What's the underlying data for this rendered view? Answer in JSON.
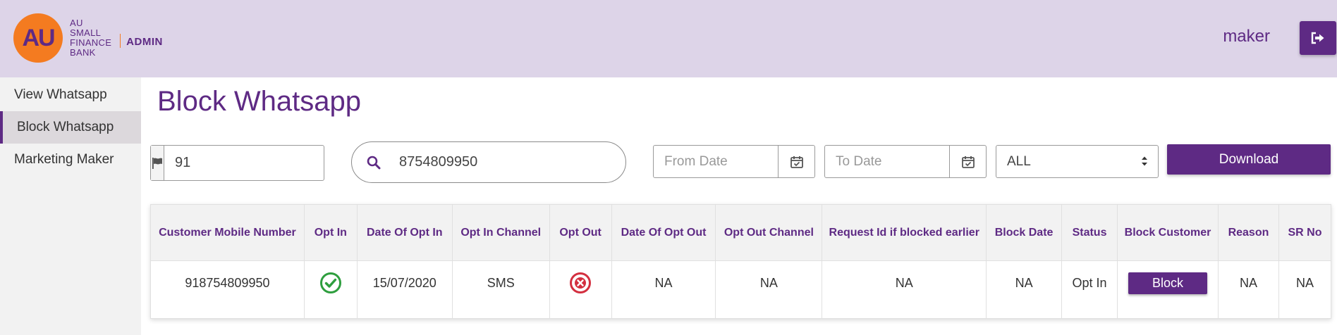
{
  "header": {
    "logo_mark": "AU",
    "logo_lines": [
      "AU",
      "SMALL",
      "FINANCE",
      "BANK"
    ],
    "logo_admin": "ADMIN",
    "user_name": "maker",
    "colors": {
      "brand_purple": "#5e2a84",
      "brand_orange": "#f47b20",
      "header_bg": "#ddd4e8"
    },
    "logout_icon": "sign-out-icon"
  },
  "sidebar": {
    "items": [
      {
        "label": "View Whatsapp",
        "active": false
      },
      {
        "label": "Block Whatsapp",
        "active": true
      },
      {
        "label": "Marketing Maker",
        "active": false
      }
    ]
  },
  "main": {
    "title": "Block Whatsapp",
    "filters": {
      "country_code": "91",
      "country_icon": "flag-icon",
      "search_value": "8754809950",
      "search_icon": "search-icon",
      "from_date_placeholder": "From Date",
      "to_date_placeholder": "To Date",
      "calendar_icon": "calendar-check-icon",
      "status_selected": "ALL",
      "download_label": "Download"
    },
    "table": {
      "headers": [
        "Customer Mobile Number",
        "Opt In",
        "Date Of Opt In",
        "Opt In Channel",
        "Opt Out",
        "Date Of Opt Out",
        "Opt Out Channel",
        "Request Id if blocked earlier",
        "Block Date",
        "Status",
        "Block Customer",
        "Reason",
        "SR No"
      ],
      "rows": [
        {
          "mobile": "918754809950",
          "opt_in_icon": "check-circle-icon",
          "date_opt_in": "15/07/2020",
          "opt_in_channel": "SMS",
          "opt_out_icon": "x-circle-icon",
          "date_opt_out": "NA",
          "opt_out_channel": "NA",
          "request_id": "NA",
          "block_date": "NA",
          "status": "Opt In",
          "block_label": "Block",
          "reason": "NA",
          "sr_no": "NA"
        }
      ]
    }
  }
}
